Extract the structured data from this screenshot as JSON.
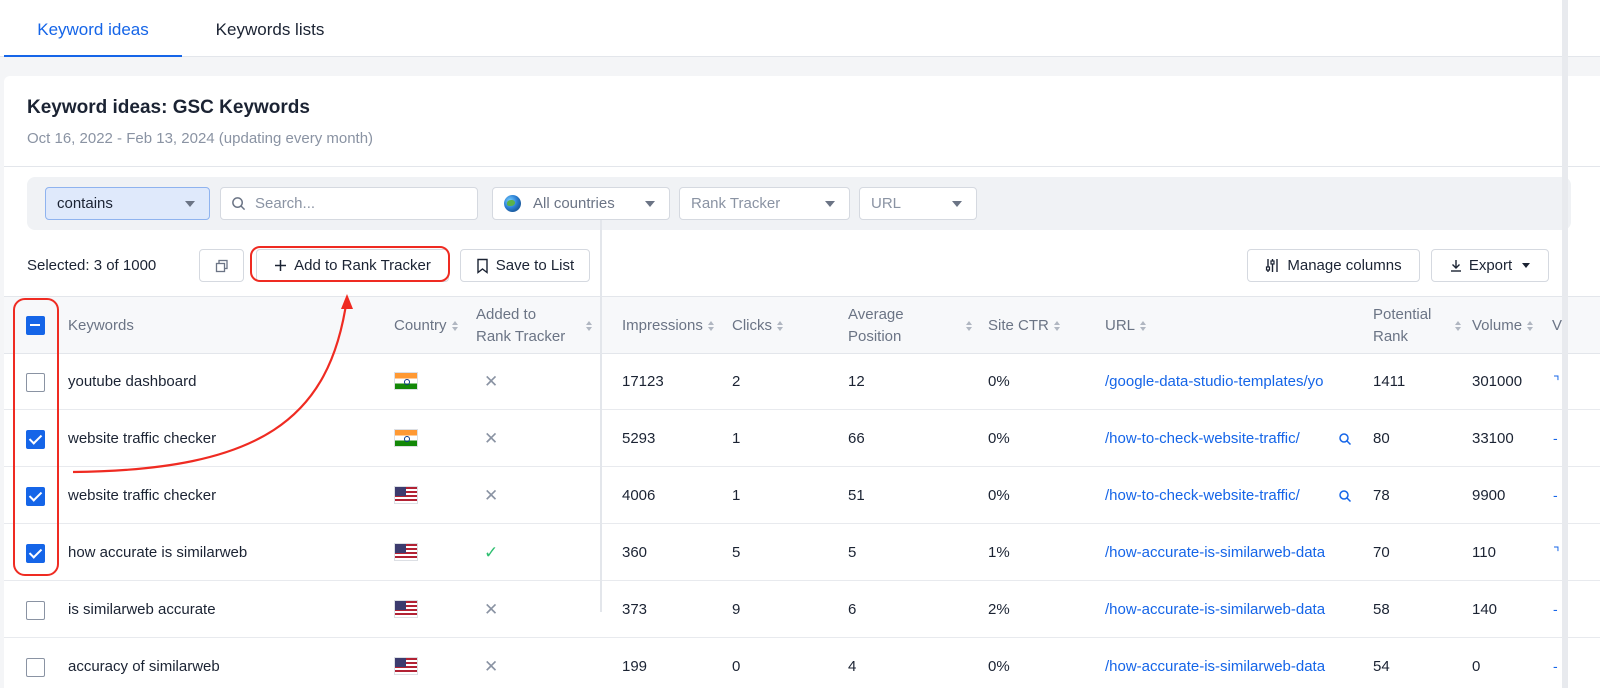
{
  "tabs": {
    "active": "Keyword ideas",
    "inactive": "Keywords lists"
  },
  "header": {
    "title": "Keyword ideas: GSC Keywords",
    "subtitle": "Oct 16, 2022 - Feb 13, 2024 (updating every month)"
  },
  "filters": {
    "match": "contains",
    "search_placeholder": "Search...",
    "countries": "All countries",
    "rank_tracker": "Rank Tracker",
    "url": "URL"
  },
  "actions": {
    "selected": "Selected: 3 of 1000",
    "add": "Add to Rank Tracker",
    "save": "Save to List",
    "manage": "Manage columns",
    "export": "Export"
  },
  "columns": {
    "keywords": "Keywords",
    "country": "Country",
    "added_line1": "Added to",
    "added_line2": "Rank Tracker",
    "impressions": "Impressions",
    "clicks": "Clicks",
    "avg_line1": "Average",
    "avg_line2": "Position",
    "ctr": "Site CTR",
    "url": "URL",
    "potential_line1": "Potential",
    "potential_line2": "Rank",
    "volume": "Volume",
    "next_fragment": "V"
  },
  "rows": [
    {
      "checked": false,
      "keyword": "youtube dashboard",
      "country": "in",
      "added": "✕",
      "added_state": false,
      "impressions": "17123",
      "clicks": "2",
      "avg": "12",
      "ctr": "0%",
      "url": "/google-data-studio-templates/yo",
      "url_search": false,
      "potential": "1411",
      "volume": "301000"
    },
    {
      "checked": true,
      "keyword": "website traffic checker",
      "country": "in",
      "added": "✕",
      "added_state": false,
      "impressions": "5293",
      "clicks": "1",
      "avg": "66",
      "ctr": "0%",
      "url": "/how-to-check-website-traffic/",
      "url_search": true,
      "potential": "80",
      "volume": "33100"
    },
    {
      "checked": true,
      "keyword": "website traffic checker",
      "country": "us",
      "added": "✕",
      "added_state": false,
      "impressions": "4006",
      "clicks": "1",
      "avg": "51",
      "ctr": "0%",
      "url": "/how-to-check-website-traffic/",
      "url_search": true,
      "potential": "78",
      "volume": "9900"
    },
    {
      "checked": true,
      "keyword": "how accurate is similarweb",
      "country": "us",
      "added": "✓",
      "added_state": true,
      "impressions": "360",
      "clicks": "5",
      "avg": "5",
      "ctr": "1%",
      "url": "/how-accurate-is-similarweb-data",
      "url_search": false,
      "potential": "70",
      "volume": "110"
    },
    {
      "checked": false,
      "keyword": "is similarweb accurate",
      "country": "us",
      "added": "✕",
      "added_state": false,
      "impressions": "373",
      "clicks": "9",
      "avg": "6",
      "ctr": "2%",
      "url": "/how-accurate-is-similarweb-data",
      "url_search": false,
      "potential": "58",
      "volume": "140"
    },
    {
      "checked": false,
      "keyword": "accuracy of similarweb",
      "country": "us",
      "added": "✕",
      "added_state": false,
      "impressions": "199",
      "clicks": "0",
      "avg": "4",
      "ctr": "0%",
      "url": "/how-accurate-is-similarweb-data",
      "url_search": false,
      "potential": "54",
      "volume": "0"
    }
  ],
  "icons": {
    "search": "search-icon",
    "globe": "globe-icon",
    "copy": "copy-icon",
    "plus": "plus-icon",
    "bookmark": "bookmark-icon",
    "columns": "columns-icon",
    "download": "download-icon",
    "flag_in": "india-flag-icon",
    "flag_us": "usa-flag-icon"
  },
  "colors": {
    "accent": "#1565e8",
    "annotation": "#ef2b22",
    "success": "#2fbf71"
  }
}
